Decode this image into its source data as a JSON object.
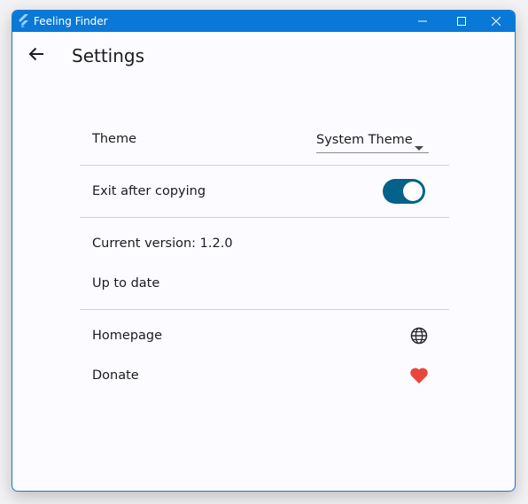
{
  "window": {
    "title": "Feeling Finder",
    "accent": "#0a78d7",
    "controls": [
      "minimize-icon",
      "maximize-icon",
      "close-icon"
    ]
  },
  "appbar": {
    "back_icon": "arrow-left-icon",
    "title": "Settings"
  },
  "settings": {
    "theme": {
      "label": "Theme",
      "selected": "System Theme",
      "icon": "caret-down-icon"
    },
    "exit_after_copying": {
      "label": "Exit after copying",
      "enabled": true,
      "color": "#04628a"
    },
    "version": {
      "label": "Current version: 1.2.0",
      "status": "Up to date"
    },
    "homepage": {
      "label": "Homepage",
      "icon": "globe-icon"
    },
    "donate": {
      "label": "Donate",
      "icon": "heart-icon",
      "color": "#e9473c"
    }
  }
}
